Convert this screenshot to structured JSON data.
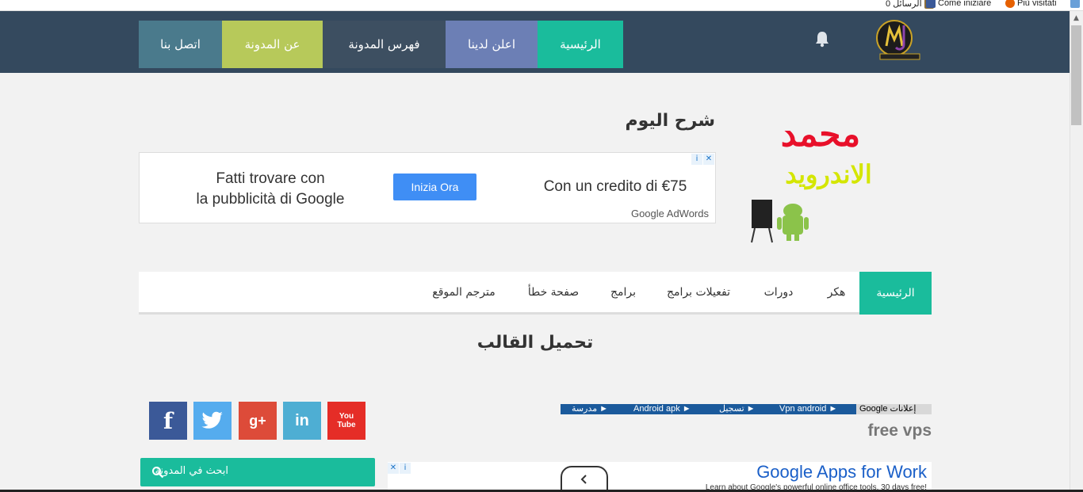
{
  "browser": {
    "bookmarks": [
      {
        "label": "0 الرسائل",
        "icon": "messages-icon",
        "color": "#8a6d3b"
      },
      {
        "label": "Come iniziare",
        "icon": "facebook-icon",
        "color": "#3b5998"
      },
      {
        "label": "Più visitati",
        "icon": "firefox-icon",
        "color": "#e66000"
      }
    ]
  },
  "topnav": {
    "items": [
      {
        "label": "الرئيسية",
        "color": "#1abc9c"
      },
      {
        "label": "اعلن لدينا",
        "color": "#6c7fb5"
      },
      {
        "label": "فهرس المدونة",
        "color": "#3d4f61"
      },
      {
        "label": "عن المدونة",
        "color": "#b7c95a"
      },
      {
        "label": "اتصل بنا",
        "color": "#4a7a8c"
      }
    ],
    "notification_icon": "bell-icon"
  },
  "header": {
    "title": "شرح اليوم"
  },
  "ad_banner": {
    "left_line1": "Fatti trovare con",
    "left_line2": "la pubblicità di Google",
    "button": "Inizia Ora",
    "right_text": "Con un credito di €75",
    "brand": "Google AdWords"
  },
  "brand_art": {
    "line1": "محمد",
    "line2": "الاندرويد"
  },
  "mainnav": {
    "items": [
      {
        "label": "الرئيسية",
        "active": true
      },
      {
        "label": "هكر",
        "active": false
      },
      {
        "label": "دورات",
        "active": false
      },
      {
        "label": "تفعيلات برامج",
        "active": false
      },
      {
        "label": "برامج",
        "active": false
      },
      {
        "label": "صفحة خطأ",
        "active": false
      },
      {
        "label": "مترجم الموقع",
        "active": false
      }
    ]
  },
  "post": {
    "title": "تحميل القالب"
  },
  "social": [
    {
      "name": "facebook",
      "glyph": "f",
      "color": "#3b5998"
    },
    {
      "name": "twitter",
      "glyph": "🐦",
      "color": "#55acee"
    },
    {
      "name": "google-plus",
      "glyph": "g+",
      "color": "#dd4b39"
    },
    {
      "name": "linkedin",
      "glyph": "in",
      "color": "#4eaed3"
    },
    {
      "name": "youtube",
      "glyph": "You Tube",
      "color": "#e52d27"
    }
  ],
  "search": {
    "placeholder": "ابحث في المدونة"
  },
  "ad_links": {
    "links": [
      "مدرسة ►",
      "Android apk ►",
      "تسجيل ►",
      "Vpn android ►"
    ],
    "tag": "Google إعلانات"
  },
  "sidebar": {
    "section_title": "free vps"
  },
  "ad2": {
    "title": "Google Apps for Work",
    "subtitle": "Learn about Google's powerful online office tools. 30 days free!"
  }
}
